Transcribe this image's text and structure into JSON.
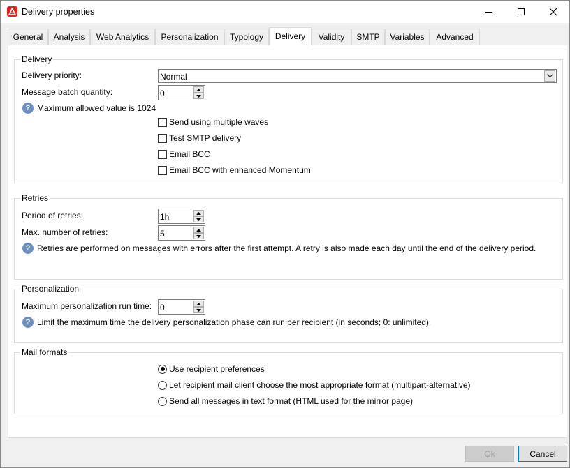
{
  "window": {
    "title": "Delivery properties"
  },
  "tabs": [
    {
      "label": "General",
      "active": false
    },
    {
      "label": "Analysis",
      "active": false
    },
    {
      "label": "Web Analytics",
      "active": false
    },
    {
      "label": "Personalization",
      "active": false
    },
    {
      "label": "Typology",
      "active": false
    },
    {
      "label": "Delivery",
      "active": true
    },
    {
      "label": "Validity",
      "active": false
    },
    {
      "label": "SMTP",
      "active": false
    },
    {
      "label": "Variables",
      "active": false
    },
    {
      "label": "Advanced",
      "active": false
    }
  ],
  "delivery": {
    "title": "Delivery",
    "priority_label": "Delivery priority:",
    "priority_value": "Normal",
    "batch_label": "Message batch quantity:",
    "batch_value": "0",
    "batch_info": "Maximum allowed value is 1024",
    "checkboxes": [
      {
        "label": "Send using multiple waves",
        "checked": false
      },
      {
        "label": "Test SMTP delivery",
        "checked": false
      },
      {
        "label": "Email BCC",
        "checked": false
      },
      {
        "label": "Email BCC with enhanced Momentum",
        "checked": false
      }
    ]
  },
  "retries": {
    "title": "Retries",
    "period_label": "Period of retries:",
    "period_value": "1h",
    "max_label": "Max. number of retries:",
    "max_value": "5",
    "info": "Retries are performed on messages with errors after the first attempt. A retry is also made each day until the end of the delivery period."
  },
  "personalization": {
    "title": "Personalization",
    "runtime_label": "Maximum personalization run time:",
    "runtime_value": "0",
    "info": "Limit the maximum time the delivery personalization phase can run per recipient (in seconds; 0: unlimited)."
  },
  "mail_formats": {
    "title": "Mail formats",
    "options": [
      {
        "label": "Use recipient preferences",
        "selected": true
      },
      {
        "label": "Let recipient mail client choose the most appropriate format (multipart-alternative)",
        "selected": false
      },
      {
        "label": "Send all messages in text format (HTML used for the mirror page)",
        "selected": false
      }
    ]
  },
  "footer": {
    "ok_label": "Ok",
    "cancel_label": "Cancel"
  },
  "colors": {
    "accent": "#0078d7",
    "brand": "#e1251b",
    "info_icon": "#6d8fbd"
  }
}
